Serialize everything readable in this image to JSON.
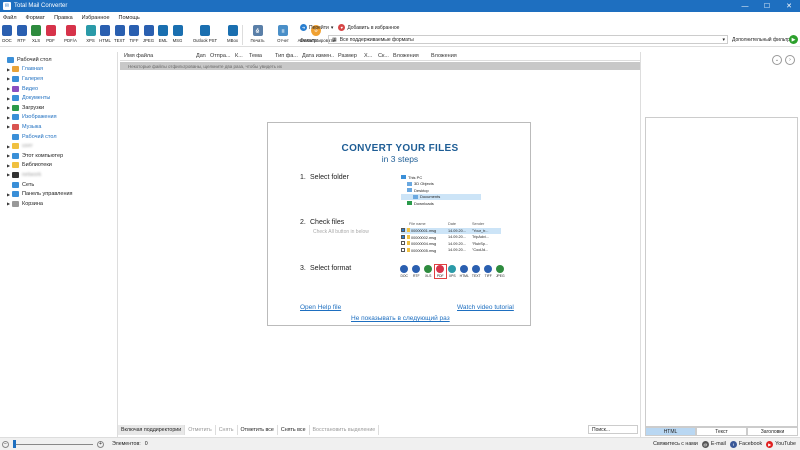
{
  "window": {
    "title": "Total Mail Converter"
  },
  "menu": [
    "Файл",
    "Формат",
    "Правка",
    "Избранное",
    "Помощь"
  ],
  "formats": [
    {
      "label": "DOC",
      "color": "#2a5fb0"
    },
    {
      "label": "RTF",
      "color": "#2a5fb0"
    },
    {
      "label": "XLS",
      "color": "#2e8b3e"
    },
    {
      "label": "PDF",
      "color": "#d6334a"
    },
    {
      "label": "PDF/A",
      "color": "#d6334a"
    },
    {
      "label": "XPS",
      "color": "#2a9aa8"
    },
    {
      "label": "HTML",
      "color": "#2a5fb0"
    },
    {
      "label": "TEXT",
      "color": "#2a5fb0"
    },
    {
      "label": "TIFF",
      "color": "#2a5fb0"
    },
    {
      "label": "JPEG",
      "color": "#2a5fb0"
    },
    {
      "label": "EML",
      "color": "#1a6fb0"
    },
    {
      "label": "MSG",
      "color": "#1a6fb0"
    },
    {
      "label": "Outlook PST",
      "color": "#1a6fb0"
    },
    {
      "label": "MBox",
      "color": "#1a6fb0"
    }
  ],
  "tools": {
    "print": "Печать",
    "report": "Отчет",
    "automate": "Автоматизировать"
  },
  "goto": {
    "label": "Перейти",
    "favorite": "Добавить в избранное"
  },
  "filter": {
    "label": "Фильтр:",
    "value": "Все поддерживаемые форматы",
    "advanced": "Дополнительный фильтр"
  },
  "tree": [
    {
      "label": "Рабочий стол",
      "color": "#3a8fd8",
      "arrow": "",
      "indent": 0,
      "link": false,
      "blur": false
    },
    {
      "label": "Главная",
      "color": "#e8a33a",
      "arrow": "▶",
      "indent": 1,
      "link": true,
      "blur": false
    },
    {
      "label": "Галерея",
      "color": "#3a8fd8",
      "arrow": "▶",
      "indent": 1,
      "link": true,
      "blur": false
    },
    {
      "label": "Видео",
      "color": "#8a4fc0",
      "arrow": "▶",
      "indent": 1,
      "link": true,
      "blur": false
    },
    {
      "label": "Документы",
      "color": "#3a8fd8",
      "arrow": "▶",
      "indent": 1,
      "link": true,
      "blur": false
    },
    {
      "label": "Загрузки",
      "color": "#2a9a4a",
      "arrow": "▶",
      "indent": 1,
      "link": false,
      "blur": false
    },
    {
      "label": "Изображения",
      "color": "#3a8fd8",
      "arrow": "▶",
      "indent": 1,
      "link": true,
      "blur": false
    },
    {
      "label": "Музыка",
      "color": "#d9534f",
      "arrow": "▶",
      "indent": 1,
      "link": true,
      "blur": false
    },
    {
      "label": "Рабочий стол",
      "color": "#3a8fd8",
      "arrow": "",
      "indent": 1,
      "link": true,
      "blur": false
    },
    {
      "label": "user",
      "color": "#f0c040",
      "arrow": "▶",
      "indent": 1,
      "link": false,
      "blur": true
    },
    {
      "label": "Этот компьютер",
      "color": "#3a8fd8",
      "arrow": "▶",
      "indent": 1,
      "link": false,
      "blur": false
    },
    {
      "label": "Библиотеки",
      "color": "#f0c040",
      "arrow": "▶",
      "indent": 1,
      "link": false,
      "blur": false
    },
    {
      "label": "network",
      "color": "#333333",
      "arrow": "▶",
      "indent": 1,
      "link": false,
      "blur": true
    },
    {
      "label": "Сеть",
      "color": "#3a8fd8",
      "arrow": "",
      "indent": 1,
      "link": false,
      "blur": false
    },
    {
      "label": "Панель управления",
      "color": "#3a8fd8",
      "arrow": "▶",
      "indent": 1,
      "link": false,
      "blur": false
    },
    {
      "label": "Корзина",
      "color": "#999999",
      "arrow": "▶",
      "indent": 1,
      "link": false,
      "blur": false
    }
  ],
  "columns": [
    {
      "label": "Имя файла",
      "w": 72
    },
    {
      "label": "Дата",
      "w": 14
    },
    {
      "label": "Отпра...",
      "w": 25
    },
    {
      "label": "К...",
      "w": 14
    },
    {
      "label": "Тема",
      "w": 26
    },
    {
      "label": "Тип фа...",
      "w": 27
    },
    {
      "label": "Дата измен...",
      "w": 36
    },
    {
      "label": "Размер",
      "w": 26
    },
    {
      "label": "Х...",
      "w": 14
    },
    {
      "label": "Ск...",
      "w": 15
    },
    {
      "label": "Вложения",
      "w": 38
    },
    {
      "label": "Вложения",
      "w": 40
    }
  ],
  "column_hint": "Некоторые файлы отфильтрованы, щелкните два раза, чтобы увидеть их",
  "welcome": {
    "title": "CONVERT YOUR FILES",
    "subtitle": "in 3 steps",
    "step1": "Select folder",
    "step2": "Check files",
    "step2_hint": "Check All button in below",
    "step3": "Select format",
    "help_link": "Open Help file",
    "video_link": "Watch video tutorial",
    "dont_show": "Не показывать в следующий раз",
    "mini_tree": [
      "This PC",
      "3D Objects",
      "Desktop",
      "Documents",
      "Downloads"
    ],
    "mini_table_headers": [
      "File name",
      "Date",
      "Sender"
    ],
    "mini_table_rows": [
      [
        "00000001.msg",
        "14.09.20...",
        "\"Your_tr..."
      ],
      [
        "00000002.msg",
        "14.09.20...",
        "TripAdvi..."
      ],
      [
        "00000004.msg",
        "14.09.20...",
        "\"RubSp..."
      ],
      [
        "00000005.msg",
        "14.09.20...",
        "\"CoolJd..."
      ]
    ],
    "mini_formats": [
      {
        "label": "DOC",
        "color": "#2a5fb0"
      },
      {
        "label": "RTF",
        "color": "#2a5fb0"
      },
      {
        "label": "XLS",
        "color": "#2e8b3e"
      },
      {
        "label": "PDF",
        "color": "#d6334a"
      },
      {
        "label": "XPS",
        "color": "#2a9aa8"
      },
      {
        "label": "HTML",
        "color": "#2a5fb0"
      },
      {
        "label": "TEXT",
        "color": "#2a5fb0"
      },
      {
        "label": "TIFF",
        "color": "#2a5fb0"
      },
      {
        "label": "JPEG",
        "color": "#2e8b3e"
      }
    ]
  },
  "bottom_buttons": [
    "Включая поддиректории",
    "Отметить",
    "Снять",
    "Отметить все",
    "Снять все",
    "Восстановить выделение"
  ],
  "search_placeholder": "Поиск...",
  "preview_tabs": [
    "HTML",
    "Текст",
    "Заголовки"
  ],
  "status": {
    "elements_label": "Элементов:",
    "elements_count": "0",
    "contact": "Свяжитесь с нами",
    "email": "E-mail",
    "facebook": "Facebook",
    "youtube": "YouTube"
  },
  "colors": {
    "accent": "#1e6fc0",
    "welcome_title": "#1e5d95"
  }
}
